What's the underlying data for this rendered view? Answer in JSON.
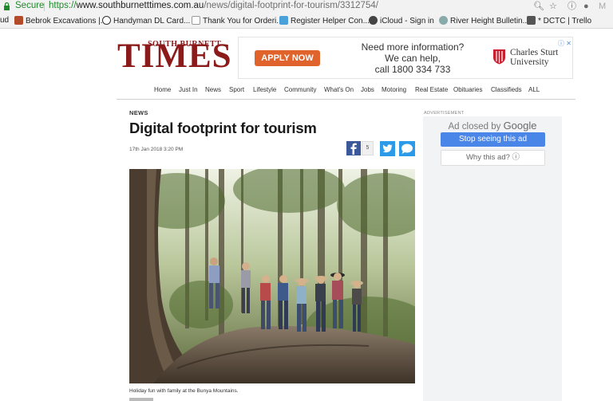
{
  "browser": {
    "secure_label": "Secure",
    "url_scheme": "https://",
    "url_domain": "www.southburnetttimes.com.au",
    "url_path": "/news/digital-footprint-for-tourism/3312754/",
    "bookmarks": [
      {
        "label": "ud"
      },
      {
        "label": "Bebrok Excavations |..."
      },
      {
        "label": "Handyman DL Card..."
      },
      {
        "label": "Thank You for Orderi..."
      },
      {
        "label": "Register Helper Con..."
      },
      {
        "label": "iCloud - Sign in"
      },
      {
        "label": "River Height Bulletin..."
      },
      {
        "label": "* DCTC | Trello"
      }
    ]
  },
  "masthead": {
    "logo_small": "SOUTH BURNETT",
    "logo_large": "TIMES"
  },
  "banner_ad": {
    "button_label": "APPLY NOW",
    "line1": "Need more information?",
    "line2": "We can help,",
    "line3": "call 1800 334 733",
    "org_line1": "Charles Sturt",
    "org_line2": "University",
    "adchoices": "ⓘ ✕"
  },
  "nav": {
    "items": [
      "Home",
      "Just In",
      "News",
      "Sport",
      "Lifestyle",
      "Community",
      "What's On",
      "Jobs",
      "Motoring",
      "Real Estate",
      "Obituaries",
      "Classifieds",
      "ALL"
    ]
  },
  "article": {
    "kicker": "NEWS",
    "headline": "Digital footprint for tourism",
    "timestamp": "17th Jan 2018 3:20 PM",
    "facebook_count": "5",
    "caption": "Holiday fun with family at the Bunya Mountains."
  },
  "sidebar": {
    "advertisement_label": "ADVERTISEMENT",
    "ad_closed_text": "Ad closed by",
    "ad_closed_brand": "Google",
    "stop_button": "Stop seeing this ad",
    "why_button": "Why this ad? ⓘ"
  },
  "colors": {
    "brand_red": "#8b1a1a",
    "apply_orange": "#e0632b",
    "facebook": "#3b5998",
    "twitter": "#2b9be9",
    "google_blue": "#4a86e8"
  }
}
